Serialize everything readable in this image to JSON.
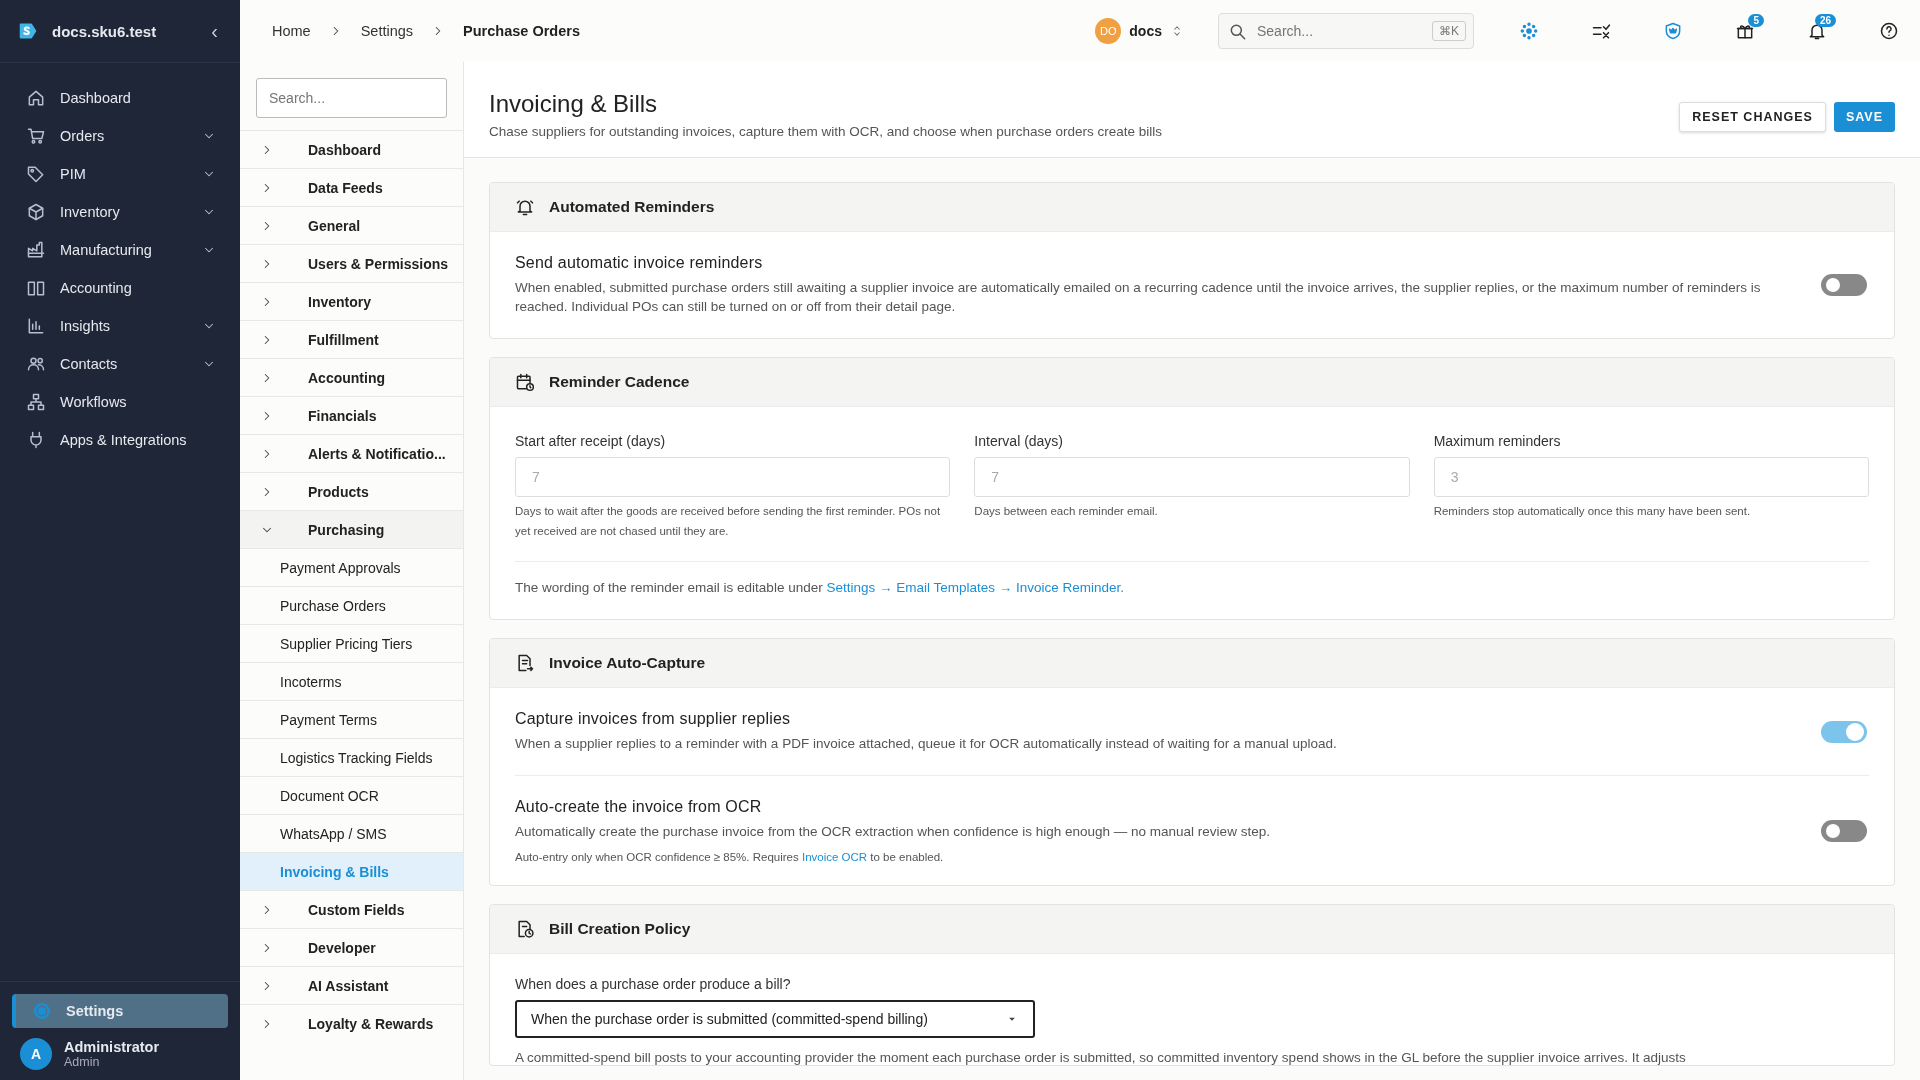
{
  "sidebar": {
    "workspace": "docs.sku6.test",
    "collapse": "‹",
    "items": [
      {
        "label": "Dashboard",
        "submenu": false
      },
      {
        "label": "Orders",
        "submenu": true
      },
      {
        "label": "PIM",
        "submenu": true
      },
      {
        "label": "Inventory",
        "submenu": true
      },
      {
        "label": "Manufacturing",
        "submenu": true
      },
      {
        "label": "Accounting",
        "submenu": false
      },
      {
        "label": "Insights",
        "submenu": true
      },
      {
        "label": "Contacts",
        "submenu": true
      },
      {
        "label": "Workflows",
        "submenu": false
      },
      {
        "label": "Apps & Integrations",
        "submenu": false
      }
    ],
    "settings": {
      "label": "Settings",
      "selected": true
    },
    "user": {
      "initial": "A",
      "name": "Administrator",
      "role": "Admin"
    }
  },
  "topbar": {
    "breadcrumbs": [
      "Home",
      "Settings",
      "Purchase Orders"
    ],
    "org": {
      "initials": "DO",
      "name": "docs"
    },
    "search": {
      "placeholder": "Search...",
      "shortcut": "⌘K"
    },
    "badges": {
      "gift": "5",
      "bell": "26"
    }
  },
  "settings_nav": {
    "search": {
      "placeholder": "Search..."
    },
    "items": [
      {
        "label": "Dashboard",
        "expanded": false,
        "selected": false
      },
      {
        "label": "Data Feeds",
        "expanded": false,
        "selected": false
      },
      {
        "label": "General",
        "expanded": false,
        "selected": false
      },
      {
        "label": "Users & Permissions",
        "expanded": false,
        "selected": false
      },
      {
        "label": "Inventory",
        "expanded": false,
        "selected": false
      },
      {
        "label": "Fulfillment",
        "expanded": false,
        "selected": false
      },
      {
        "label": "Accounting",
        "expanded": false,
        "selected": false
      },
      {
        "label": "Financials",
        "expanded": false,
        "selected": false
      },
      {
        "label": "Alerts & Notificatio...",
        "expanded": false,
        "selected": false
      },
      {
        "label": "Products",
        "expanded": false,
        "selected": false
      },
      {
        "label": "Purchasing",
        "expanded": true,
        "selected": false,
        "children": [
          {
            "label": "Payment Approvals",
            "selected": false
          },
          {
            "label": "Purchase Orders",
            "selected": false
          },
          {
            "label": "Supplier Pricing Tiers",
            "selected": false
          },
          {
            "label": "Incoterms",
            "selected": false
          },
          {
            "label": "Payment Terms",
            "selected": false
          },
          {
            "label": "Logistics Tracking Fields",
            "selected": false
          },
          {
            "label": "Document OCR",
            "selected": false
          },
          {
            "label": "WhatsApp / SMS",
            "selected": false
          },
          {
            "label": "Invoicing & Bills",
            "selected": true
          }
        ]
      },
      {
        "label": "Custom Fields",
        "expanded": false,
        "selected": false
      },
      {
        "label": "Developer",
        "expanded": false,
        "selected": false
      },
      {
        "label": "AI Assistant",
        "expanded": false,
        "selected": false
      },
      {
        "label": "Loyalty & Rewards",
        "expanded": false,
        "selected": false
      }
    ]
  },
  "page": {
    "title": "Invoicing & Bills",
    "subtitle": "Chase suppliers for outstanding invoices, capture them with OCR, and choose when purchase orders create bills",
    "buttons": [
      {
        "label": "RESET CHANGES",
        "kind": "outlined"
      },
      {
        "label": "SAVE",
        "kind": "primary"
      }
    ]
  },
  "sections": [
    {
      "title": "Automated Reminders",
      "blocks": [
        {
          "kind": "toggle",
          "title": "Send automatic invoice reminders",
          "description": "When enabled, submitted purchase orders still awaiting a supplier invoice are automatically emailed on a recurring cadence until the invoice arrives, the supplier replies, or the maximum number of reminders is reached. Individual POs can still be turned on or off from their detail page.",
          "on": false
        }
      ]
    },
    {
      "title": "Reminder Cadence",
      "blocks": [
        {
          "kind": "fields",
          "fields": [
            {
              "label": "Start after receipt (days)",
              "placeholder": "7",
              "help": "Days to wait after the goods are received before sending the first reminder. POs not yet received are not chased until they are."
            },
            {
              "label": "Interval (days)",
              "placeholder": "7",
              "help": "Days between each reminder email."
            },
            {
              "label": "Maximum reminders",
              "placeholder": "3",
              "help": "Reminders stop automatically once this many have been sent."
            }
          ]
        },
        {
          "kind": "note",
          "parts": [
            {
              "text": "The wording of the reminder email is editable under "
            },
            {
              "link": "Settings → Email Templates → Invoice Reminder."
            }
          ]
        }
      ]
    },
    {
      "title": "Invoice Auto-Capture",
      "blocks": [
        {
          "kind": "toggle",
          "title": "Capture invoices from supplier replies",
          "description": "When a supplier replies to a reminder with a PDF invoice attached, queue it for OCR automatically instead of waiting for a manual upload.",
          "on": true
        },
        {
          "kind": "toggle",
          "title": "Auto-create the invoice from OCR",
          "description": "Automatically create the purchase invoice from the OCR extraction when confidence is high enough — no manual review step.",
          "on": false,
          "note": [
            {
              "text": "Auto-entry only when OCR confidence ≥ 85%. Requires "
            },
            {
              "link": "Invoice OCR"
            },
            {
              "text": " to be enabled."
            }
          ]
        }
      ]
    },
    {
      "title": "Bill Creation Policy",
      "blocks": [
        {
          "kind": "select",
          "label": "When does a purchase order produce a bill?",
          "value": "When the purchase order is submitted (committed-spend billing)",
          "help": "A committed-spend bill posts to your accounting provider the moment each purchase order is submitted, so committed inventory spend shows in the GL before the supplier invoice arrives. It adjusts"
        }
      ]
    }
  ]
}
